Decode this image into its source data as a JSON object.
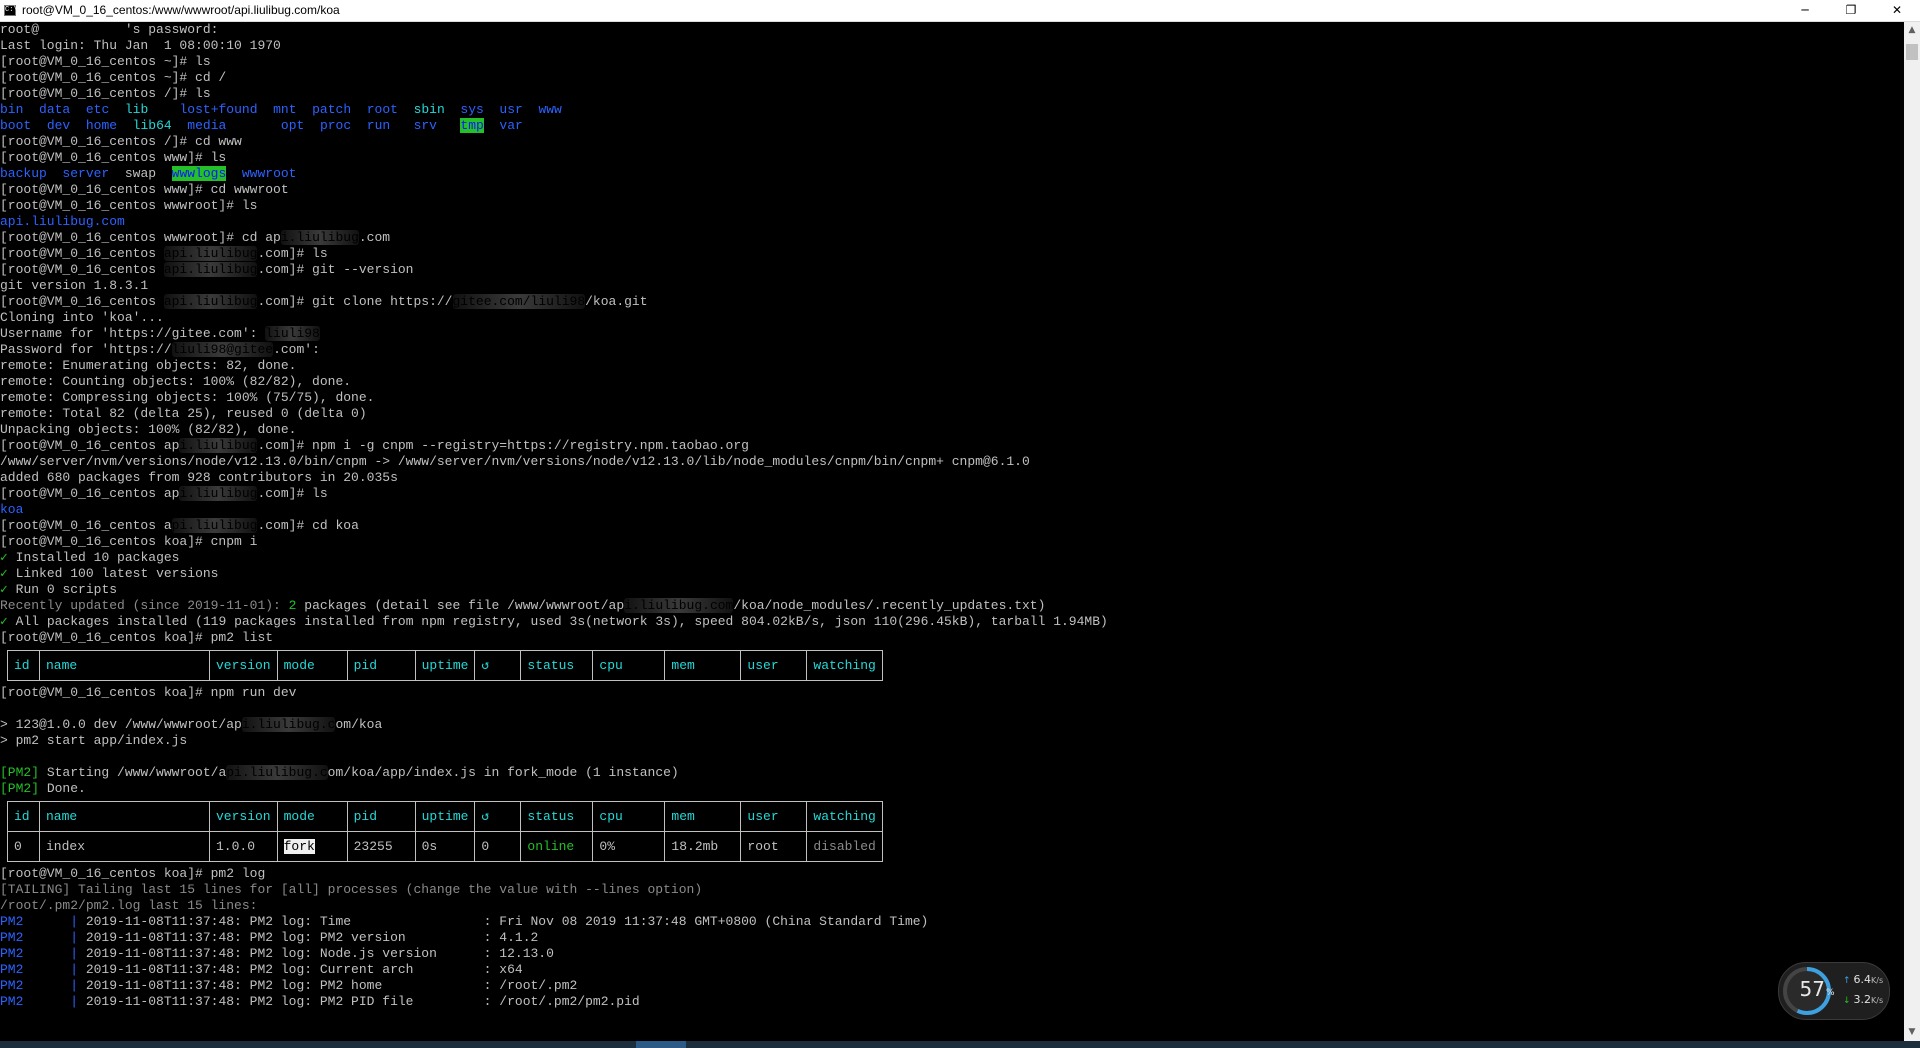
{
  "window": {
    "icon_label": "C:\\",
    "title": "root@VM_0_16_centos:/www/wwwroot/api.liulibug.com/koa",
    "buttons": {
      "minimize": "─",
      "maximize": "❐",
      "close": "✕"
    }
  },
  "terminal": {
    "l1": "root@           's password:",
    "l2": "Last login: Thu Jan  1 08:00:10 1970",
    "l3": "[root@VM_0_16_centos ~]# ls",
    "l4": "[root@VM_0_16_centos ~]# cd /",
    "l5": "[root@VM_0_16_centos /]# ls",
    "ls_root_row1": [
      {
        "t": "bin",
        "c": "blue"
      },
      {
        "t": "  "
      },
      {
        "t": "data",
        "c": "blue"
      },
      {
        "t": "  "
      },
      {
        "t": "etc",
        "c": "blue"
      },
      {
        "t": "  "
      },
      {
        "t": "lib",
        "c": "cyan"
      },
      {
        "t": "    "
      },
      {
        "t": "lost+found",
        "c": "blue"
      },
      {
        "t": "  "
      },
      {
        "t": "mnt",
        "c": "blue"
      },
      {
        "t": "  "
      },
      {
        "t": "patch",
        "c": "blue"
      },
      {
        "t": "  "
      },
      {
        "t": "root",
        "c": "blue"
      },
      {
        "t": "  "
      },
      {
        "t": "sbin",
        "c": "cyan"
      },
      {
        "t": "  "
      },
      {
        "t": "sys",
        "c": "blue"
      },
      {
        "t": "  "
      },
      {
        "t": "usr",
        "c": "blue"
      },
      {
        "t": "  "
      },
      {
        "t": "www",
        "c": "blue"
      }
    ],
    "ls_root_row2": [
      {
        "t": "boot",
        "c": "blue"
      },
      {
        "t": "  "
      },
      {
        "t": "dev",
        "c": "blue"
      },
      {
        "t": "  "
      },
      {
        "t": "home",
        "c": "blue"
      },
      {
        "t": "  "
      },
      {
        "t": "lib64",
        "c": "cyan"
      },
      {
        "t": "  "
      },
      {
        "t": "media",
        "c": "blue"
      },
      {
        "t": "       "
      },
      {
        "t": "opt",
        "c": "blue"
      },
      {
        "t": "  "
      },
      {
        "t": "proc",
        "c": "blue"
      },
      {
        "t": "  "
      },
      {
        "t": "run",
        "c": "blue"
      },
      {
        "t": "   "
      },
      {
        "t": "srv",
        "c": "blue"
      },
      {
        "t": "   "
      },
      {
        "t": "tmp",
        "c": "hlgreen"
      },
      {
        "t": "  "
      },
      {
        "t": "var",
        "c": "blue"
      }
    ],
    "l8": "[root@VM_0_16_centos /]# cd www",
    "l9": "[root@VM_0_16_centos www]# ls",
    "ls_www": [
      {
        "t": "backup",
        "c": "blue"
      },
      {
        "t": "  "
      },
      {
        "t": "server",
        "c": "blue"
      },
      {
        "t": "  swap  "
      },
      {
        "t": "wwwlogs",
        "c": "hlgreen"
      },
      {
        "t": "  "
      },
      {
        "t": "wwwroot",
        "c": "blue"
      }
    ],
    "l11": "[root@VM_0_16_centos www]# cd wwwroot",
    "l12": "[root@VM_0_16_centos wwwroot]# ls",
    "l13": "api.liulibug.com",
    "l14a": "[root@VM_0_16_centos wwwroot]# cd ap",
    "l14m": "i.liulibug",
    "l14b": ".com",
    "l15a": "[root@VM_0_16_centos ",
    "l15m": "api.liulibug",
    "l15b": ".com]# ls",
    "l16a": "[root@VM_0_16_centos ",
    "l16m": "api.liulibug",
    "l16b": ".com]# git --version",
    "l17": "git version 1.8.3.1",
    "l18a": "[root@VM_0_16_centos ",
    "l18m": "api.liulibug",
    "l18b": ".com]# git clone https://",
    "l18m2": "gitee.com/liuli98",
    "l18c": "/koa.git",
    "l19": "Cloning into 'koa'...",
    "l20a": "Username for 'https://gitee.com': ",
    "l20m": "liuli98",
    "l21a": "Password for 'https://",
    "l21m": "liuli98@gitee",
    "l21b": ".com':",
    "l22": "remote: Enumerating objects: 82, done.",
    "l23": "remote: Counting objects: 100% (82/82), done.",
    "l24": "remote: Compressing objects: 100% (75/75), done.",
    "l25": "remote: Total 82 (delta 25), reused 0 (delta 0)",
    "l26": "Unpacking objects: 100% (82/82), done.",
    "l27a": "[root@VM_0_16_centos ap",
    "l27m": "i.liulibug",
    "l27b": ".com]# npm i -g cnpm --registry=https://registry.npm.taobao.org",
    "l28": "/www/server/nvm/versions/node/v12.13.0/bin/cnpm -> /www/server/nvm/versions/node/v12.13.0/lib/node_modules/cnpm/bin/cnpm+ cnpm@6.1.0",
    "l29": "added 680 packages from 928 contributors in 20.035s",
    "l30a": "[root@VM_0_16_centos ap",
    "l30m": "i.liulibug",
    "l30b": ".com]# ls",
    "l31": "koa",
    "l32a": "[root@VM_0_16_centos a",
    "l32m": "pi.liulibug",
    "l32b": ".com]# cd koa",
    "l33": "[root@VM_0_16_centos koa]# cnpm i",
    "l34": "Installed 10 packages",
    "l35": "Linked 100 latest versions",
    "l36": "Run 0 scripts",
    "check": "✓",
    "l37a": "Recently updated (since 2019-11-01): ",
    "l37n": "2",
    "l37b": " packages (detail see file /www/wwwroot/ap",
    "l37m": "i.liulibug.com",
    "l37c": "/koa/node_modules/.recently_updates.txt)",
    "l38": "All packages installed (119 packages installed from npm registry, used 3s(network 3s), speed 804.02kB/s, json 110(296.45kB), tarball 1.94MB)",
    "l39": "[root@VM_0_16_centos koa]# pm2 list",
    "l40": "[root@VM_0_16_centos koa]# npm run dev",
    "l41a": "> 123@1.0.0 dev /www/wwwroot/ap",
    "l41m": "i.liulibug.c",
    "l41b": "om/koa",
    "l42": "> pm2 start app/index.js",
    "pm2_tag": "[PM2]",
    "l43a": " Starting /www/wwwroot/a",
    "l43m": "pi.liulibug.c",
    "l43b": "om/koa/app/index.js in fork_mode (1 instance)",
    "l44": " Done.",
    "l45": "[root@VM_0_16_centos koa]# pm2 log",
    "l46": "[TAILING] Tailing last 15 lines for [all] processes (change the value with --lines option)",
    "l47": "/root/.pm2/pm2.log last 15 lines:",
    "log_prefix": "PM2",
    "log_sep": "      |",
    "log_lines": [
      "2019-11-08T11:37:48: PM2 log: Time                 : Fri Nov 08 2019 11:37:48 GMT+0800 (China Standard Time)",
      "2019-11-08T11:37:48: PM2 log: PM2 version          : 4.1.2",
      "2019-11-08T11:37:48: PM2 log: Node.js version      : 12.13.0",
      "2019-11-08T11:37:48: PM2 log: Current arch         : x64",
      "2019-11-08T11:37:48: PM2 log: PM2 home             : /root/.pm2",
      "2019-11-08T11:37:48: PM2 log: PM2 PID file         : /root/.pm2/pm2.pid"
    ]
  },
  "pm2_table": {
    "headers": [
      "id",
      "name",
      "version",
      "mode",
      "pid",
      "uptime",
      "↺",
      "status",
      "cpu",
      "mem",
      "user",
      "watching"
    ],
    "row": [
      "0",
      "index",
      "1.0.0",
      "fork",
      "23255",
      "0s",
      "0",
      "online",
      "0%",
      "18.2mb",
      "root",
      "disabled"
    ]
  },
  "net_widget": {
    "percent": "57",
    "percent_unit": "%",
    "percent_value": 57,
    "up_value": "6.4",
    "up_unit": "K/s",
    "up_arrow": "↑",
    "down_value": "3.2",
    "down_unit": "K/s",
    "down_arrow": "↓"
  },
  "colors": {
    "dir": "#2c62ff",
    "link_dir": "#25d8d8",
    "success": "#25c027",
    "text": "#c0c0c0"
  }
}
